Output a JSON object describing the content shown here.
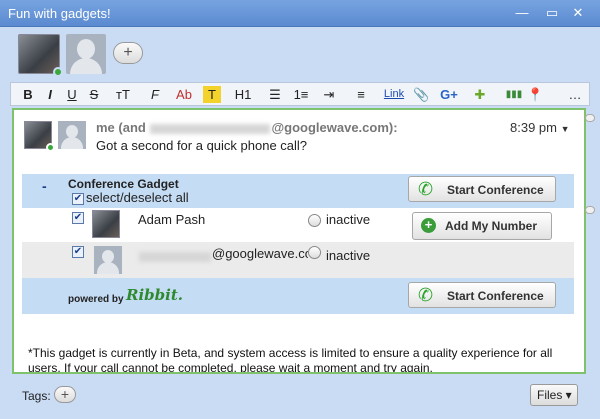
{
  "window": {
    "title": "Fun with gadgets!",
    "close": "✕",
    "restore": "▭",
    "minimize": "—"
  },
  "participants": {
    "add_label": "+"
  },
  "toolbar": {
    "bold": "B",
    "italic": "I",
    "underline": "U",
    "strike": "S",
    "text_size": "тT",
    "font": "F",
    "color": "Ab",
    "highlight": "T",
    "heading": "H1",
    "bullets": "☰",
    "align": "≡",
    "link": "Link",
    "attach": "📎",
    "google_plus": "G+",
    "gadget": "✚",
    "bars": "▮▮▮",
    "map": "📍",
    "more": "…"
  },
  "blip": {
    "from_prefix": "me (and",
    "from_suffix": "@googlewave.com):",
    "time": "8:39 pm",
    "message": "Got a second for a quick phone call?"
  },
  "gadget": {
    "collapse": "-",
    "title": "Conference Gadget",
    "select_all": "select/deselect all",
    "start_conference": "Start Conference",
    "add_my_number": "Add My Number",
    "participants": [
      {
        "name": "Adam Pash",
        "status": "inactive"
      },
      {
        "name": "@googlewave.co",
        "status": "inactive"
      }
    ],
    "powered_by": "powered by",
    "brand": "Ribbit."
  },
  "note": "*This gadget is currently in Beta, and system access is limited to ensure a quality experience for all users. If your call cannot be completed, please wait a moment and try again.",
  "footer": {
    "tags_label": "Tags:",
    "add_tag": "+",
    "files": "Files ▾"
  },
  "colors": {
    "titlebar": "#5a8ad0",
    "wave_bg": "#c9dcf4",
    "blip_border": "#7ec36b",
    "gadget_band": "#c5dcf5"
  }
}
